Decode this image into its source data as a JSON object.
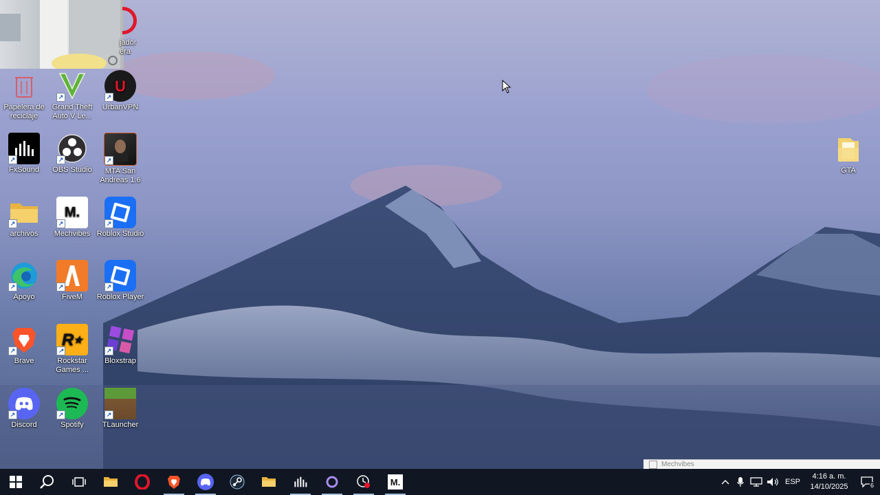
{
  "desktop": {
    "top_partial_label": [
      "jador",
      "era"
    ],
    "icons": [
      {
        "name": "recycle-bin",
        "label": "Papelera de reciclaje",
        "icon": "recycle-bin-icon",
        "color": "#d85d6a"
      },
      {
        "name": "gta-v",
        "label": "Grand Theft Auto V Le...",
        "icon": "gta-v-icon",
        "color": "#6fbf3f"
      },
      {
        "name": "urbanvpn",
        "label": "UrbanVPN",
        "icon": "urbanvpn-icon",
        "color": "#c8102e"
      },
      {
        "name": "fxsound",
        "label": "FxSound",
        "icon": "fxsound-icon",
        "color": "#000000"
      },
      {
        "name": "obs-studio",
        "label": "OBS Studio",
        "icon": "obs-icon",
        "color": "#302e31"
      },
      {
        "name": "mta-san-andreas",
        "label": "MTA San Andreas 1.6",
        "icon": "mta-icon",
        "color": "#2b2b2b"
      },
      {
        "name": "archivos",
        "label": "archivos",
        "icon": "folder-icon",
        "color": "#f2c14e"
      },
      {
        "name": "mechvibes",
        "label": "Mechvibes",
        "icon": "mechvibes-icon",
        "color": "#ffffff"
      },
      {
        "name": "roblox-studio",
        "label": "Roblox Studio",
        "icon": "roblox-studio-icon",
        "color": "#1b6ff5"
      },
      {
        "name": "apoyo",
        "label": "Apoyo",
        "icon": "edge-icon",
        "color": "#1f9bd9"
      },
      {
        "name": "fivem",
        "label": "FiveM",
        "icon": "fivem-icon",
        "color": "#f27b2a"
      },
      {
        "name": "roblox-player",
        "label": "Roblox Player",
        "icon": "roblox-player-icon",
        "color": "#1b6ff5"
      },
      {
        "name": "brave",
        "label": "Brave",
        "icon": "brave-icon",
        "color": "#fb542b"
      },
      {
        "name": "rockstar-games",
        "label": "Rockstar Games ...",
        "icon": "rockstar-icon",
        "color": "#fcaf17"
      },
      {
        "name": "bloxstrap",
        "label": "Bloxstrap",
        "icon": "bloxstrap-icon",
        "color": "#8a3fd1"
      },
      {
        "name": "discord",
        "label": "Discord",
        "icon": "discord-icon",
        "color": "#5865f2"
      },
      {
        "name": "spotify",
        "label": "Spotify",
        "icon": "spotify-icon",
        "color": "#1db954"
      },
      {
        "name": "tlauncher",
        "label": "TLauncher",
        "icon": "tlauncher-icon",
        "color": "#5c8a3a"
      },
      {
        "name": "gta-folder",
        "label": "GTA",
        "icon": "folder-icon",
        "color": "#f2d26e"
      }
    ]
  },
  "mini_window": {
    "title": "Mechvibes"
  },
  "taskbar": {
    "apps": [
      {
        "name": "start",
        "icon": "windows-icon"
      },
      {
        "name": "search",
        "icon": "search-icon"
      },
      {
        "name": "task-view",
        "icon": "task-view-icon"
      },
      {
        "name": "file-explorer",
        "icon": "folder-icon"
      },
      {
        "name": "opera",
        "icon": "opera-icon"
      },
      {
        "name": "brave",
        "icon": "brave-icon"
      },
      {
        "name": "discord",
        "icon": "discord-icon"
      },
      {
        "name": "steam",
        "icon": "steam-icon"
      },
      {
        "name": "explorer-2",
        "icon": "folder-icon"
      },
      {
        "name": "fxsound",
        "icon": "fxsound-icon"
      },
      {
        "name": "cortana",
        "icon": "ring-icon"
      },
      {
        "name": "obs",
        "icon": "obs-record-icon"
      },
      {
        "name": "mechvibes",
        "icon": "mechvibes-icon"
      }
    ],
    "tray": {
      "language": "ESP",
      "time": "4:16 a. m.",
      "date": "14/10/2025",
      "notifications": "6"
    }
  }
}
